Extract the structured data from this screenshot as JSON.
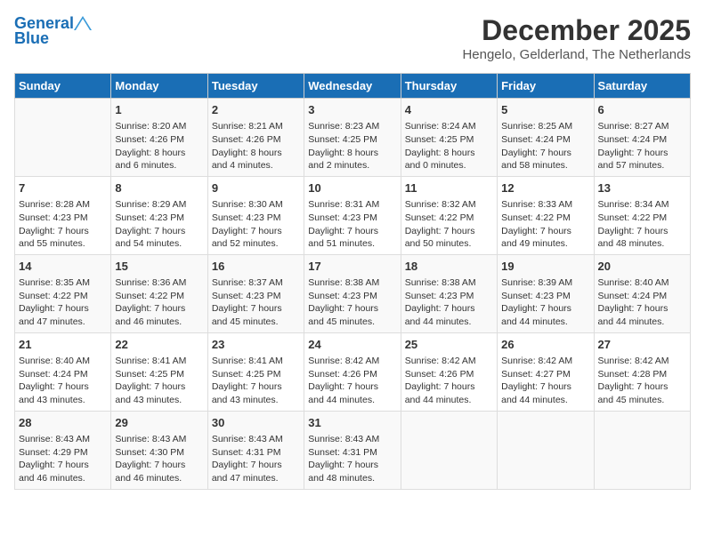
{
  "header": {
    "logo_line1": "General",
    "logo_line2": "Blue",
    "month": "December 2025",
    "location": "Hengelo, Gelderland, The Netherlands"
  },
  "weekdays": [
    "Sunday",
    "Monday",
    "Tuesday",
    "Wednesday",
    "Thursday",
    "Friday",
    "Saturday"
  ],
  "weeks": [
    [
      {
        "day": "",
        "info": ""
      },
      {
        "day": "1",
        "info": "Sunrise: 8:20 AM\nSunset: 4:26 PM\nDaylight: 8 hours\nand 6 minutes."
      },
      {
        "day": "2",
        "info": "Sunrise: 8:21 AM\nSunset: 4:26 PM\nDaylight: 8 hours\nand 4 minutes."
      },
      {
        "day": "3",
        "info": "Sunrise: 8:23 AM\nSunset: 4:25 PM\nDaylight: 8 hours\nand 2 minutes."
      },
      {
        "day": "4",
        "info": "Sunrise: 8:24 AM\nSunset: 4:25 PM\nDaylight: 8 hours\nand 0 minutes."
      },
      {
        "day": "5",
        "info": "Sunrise: 8:25 AM\nSunset: 4:24 PM\nDaylight: 7 hours\nand 58 minutes."
      },
      {
        "day": "6",
        "info": "Sunrise: 8:27 AM\nSunset: 4:24 PM\nDaylight: 7 hours\nand 57 minutes."
      }
    ],
    [
      {
        "day": "7",
        "info": "Sunrise: 8:28 AM\nSunset: 4:23 PM\nDaylight: 7 hours\nand 55 minutes."
      },
      {
        "day": "8",
        "info": "Sunrise: 8:29 AM\nSunset: 4:23 PM\nDaylight: 7 hours\nand 54 minutes."
      },
      {
        "day": "9",
        "info": "Sunrise: 8:30 AM\nSunset: 4:23 PM\nDaylight: 7 hours\nand 52 minutes."
      },
      {
        "day": "10",
        "info": "Sunrise: 8:31 AM\nSunset: 4:23 PM\nDaylight: 7 hours\nand 51 minutes."
      },
      {
        "day": "11",
        "info": "Sunrise: 8:32 AM\nSunset: 4:22 PM\nDaylight: 7 hours\nand 50 minutes."
      },
      {
        "day": "12",
        "info": "Sunrise: 8:33 AM\nSunset: 4:22 PM\nDaylight: 7 hours\nand 49 minutes."
      },
      {
        "day": "13",
        "info": "Sunrise: 8:34 AM\nSunset: 4:22 PM\nDaylight: 7 hours\nand 48 minutes."
      }
    ],
    [
      {
        "day": "14",
        "info": "Sunrise: 8:35 AM\nSunset: 4:22 PM\nDaylight: 7 hours\nand 47 minutes."
      },
      {
        "day": "15",
        "info": "Sunrise: 8:36 AM\nSunset: 4:22 PM\nDaylight: 7 hours\nand 46 minutes."
      },
      {
        "day": "16",
        "info": "Sunrise: 8:37 AM\nSunset: 4:23 PM\nDaylight: 7 hours\nand 45 minutes."
      },
      {
        "day": "17",
        "info": "Sunrise: 8:38 AM\nSunset: 4:23 PM\nDaylight: 7 hours\nand 45 minutes."
      },
      {
        "day": "18",
        "info": "Sunrise: 8:38 AM\nSunset: 4:23 PM\nDaylight: 7 hours\nand 44 minutes."
      },
      {
        "day": "19",
        "info": "Sunrise: 8:39 AM\nSunset: 4:23 PM\nDaylight: 7 hours\nand 44 minutes."
      },
      {
        "day": "20",
        "info": "Sunrise: 8:40 AM\nSunset: 4:24 PM\nDaylight: 7 hours\nand 44 minutes."
      }
    ],
    [
      {
        "day": "21",
        "info": "Sunrise: 8:40 AM\nSunset: 4:24 PM\nDaylight: 7 hours\nand 43 minutes."
      },
      {
        "day": "22",
        "info": "Sunrise: 8:41 AM\nSunset: 4:25 PM\nDaylight: 7 hours\nand 43 minutes."
      },
      {
        "day": "23",
        "info": "Sunrise: 8:41 AM\nSunset: 4:25 PM\nDaylight: 7 hours\nand 43 minutes."
      },
      {
        "day": "24",
        "info": "Sunrise: 8:42 AM\nSunset: 4:26 PM\nDaylight: 7 hours\nand 44 minutes."
      },
      {
        "day": "25",
        "info": "Sunrise: 8:42 AM\nSunset: 4:26 PM\nDaylight: 7 hours\nand 44 minutes."
      },
      {
        "day": "26",
        "info": "Sunrise: 8:42 AM\nSunset: 4:27 PM\nDaylight: 7 hours\nand 44 minutes."
      },
      {
        "day": "27",
        "info": "Sunrise: 8:42 AM\nSunset: 4:28 PM\nDaylight: 7 hours\nand 45 minutes."
      }
    ],
    [
      {
        "day": "28",
        "info": "Sunrise: 8:43 AM\nSunset: 4:29 PM\nDaylight: 7 hours\nand 46 minutes."
      },
      {
        "day": "29",
        "info": "Sunrise: 8:43 AM\nSunset: 4:30 PM\nDaylight: 7 hours\nand 46 minutes."
      },
      {
        "day": "30",
        "info": "Sunrise: 8:43 AM\nSunset: 4:31 PM\nDaylight: 7 hours\nand 47 minutes."
      },
      {
        "day": "31",
        "info": "Sunrise: 8:43 AM\nSunset: 4:31 PM\nDaylight: 7 hours\nand 48 minutes."
      },
      {
        "day": "",
        "info": ""
      },
      {
        "day": "",
        "info": ""
      },
      {
        "day": "",
        "info": ""
      }
    ]
  ]
}
